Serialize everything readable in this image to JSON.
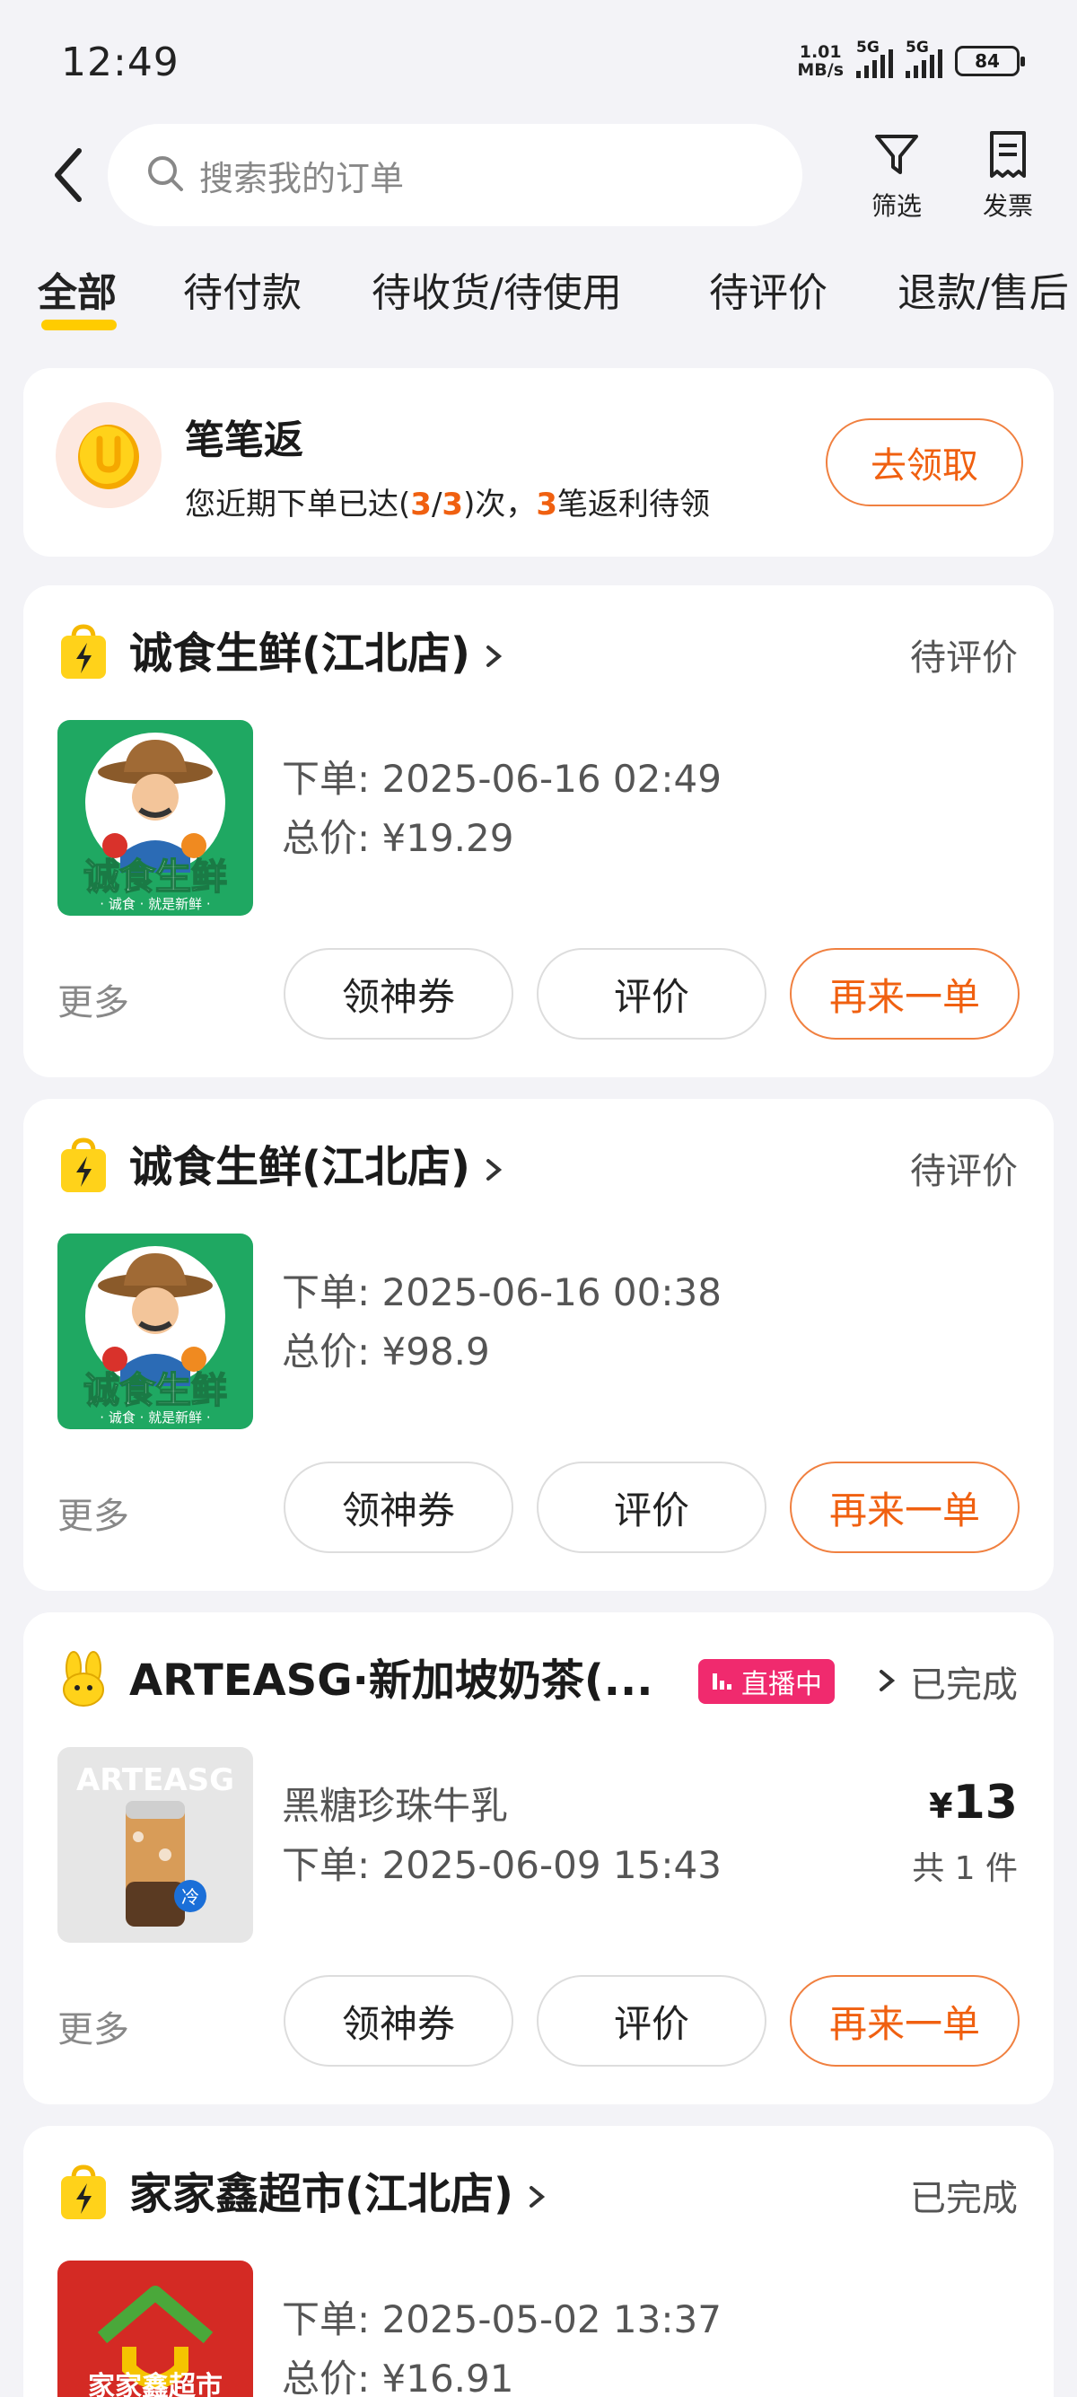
{
  "status_bar": {
    "time": "12:49",
    "net_speed_value": "1.01",
    "net_speed_unit": "MB/s",
    "sim1_label": "5G",
    "sim2_label": "5G",
    "battery": "84"
  },
  "header": {
    "search_placeholder": "搜索我的订单",
    "filter_label": "筛选",
    "invoice_label": "发票"
  },
  "tabs": [
    {
      "label": "全部",
      "active": true
    },
    {
      "label": "待付款"
    },
    {
      "label": "待收货/待使用"
    },
    {
      "label": "待评价"
    },
    {
      "label": "退款/售后"
    }
  ],
  "promo": {
    "title": "笔笔返",
    "desc_a": "您近期下单已达(",
    "desc_n1": "3",
    "desc_slash": "/",
    "desc_n2": "3",
    "desc_b": ")次，",
    "desc_n3": "3",
    "desc_c": "笔返利待领",
    "button": "去领取"
  },
  "orders": [
    {
      "store": "诚食生鲜(江北店)",
      "status": "待评价",
      "line1": "下单: 2025-06-16 02:49",
      "line2": "总价: ¥19.29",
      "more": "更多",
      "btn1": "领神券",
      "btn2": "评价",
      "btn3": "再来一单",
      "logo_text": "诚食生鲜",
      "logo_sub": "· 诚食 · 就是新鲜 ·"
    },
    {
      "store": "诚食生鲜(江北店)",
      "status": "待评价",
      "line1": "下单: 2025-06-16 00:38",
      "line2": "总价: ¥98.9",
      "more": "更多",
      "btn1": "领神券",
      "btn2": "评价",
      "btn3": "再来一单",
      "logo_text": "诚食生鲜",
      "logo_sub": "· 诚食 · 就是新鲜 ·"
    },
    {
      "store": "ARTEASG·新加坡奶茶(...",
      "live_badge": "直播中",
      "status": "已完成",
      "line1": "黑糖珍珠牛乳",
      "line2": "下单: 2025-06-09 15:43",
      "price_symbol": "¥",
      "price_value": "13",
      "quantity": "共 1 件",
      "more": "更多",
      "btn1": "领神券",
      "btn2": "评价",
      "btn3": "再来一单",
      "thumb_text": "ARTEASG",
      "thumb_badge": "冷"
    },
    {
      "store": "家家鑫超市(江北店)",
      "status": "已完成",
      "line1": "下单: 2025-05-02 13:37",
      "line2": "总价: ¥16.91",
      "logo_text": "家家鑫超市"
    }
  ]
}
